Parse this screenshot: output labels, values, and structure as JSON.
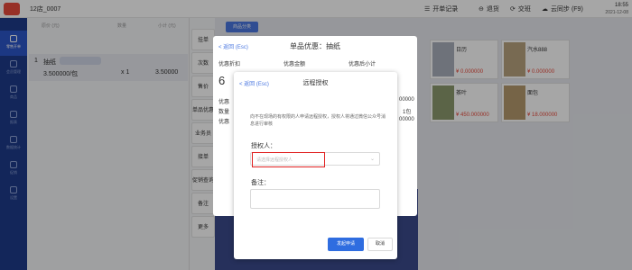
{
  "header": {
    "store": "12店_0007",
    "actions": [
      "开单记录",
      "退货",
      "交班",
      "云同步 (F9)"
    ],
    "time": "18:55",
    "date": "2021-12-08"
  },
  "sidebar": {
    "items": [
      {
        "label": "零售开单",
        "icon": "cart-icon"
      },
      {
        "label": "会员管理",
        "icon": "member-icon"
      },
      {
        "label": "商品",
        "icon": "goods-icon"
      },
      {
        "label": "报表",
        "icon": "report-icon"
      },
      {
        "label": "数据统计",
        "icon": "chart-icon"
      },
      {
        "label": "促销",
        "icon": "promo-icon"
      },
      {
        "label": "设置",
        "icon": "settings-icon"
      }
    ]
  },
  "cart": {
    "headers": {
      "price": "原价 (元)",
      "qty": "数量",
      "subtotal": "小计 (元)"
    },
    "row": {
      "index": "1",
      "name": "抽纸",
      "price": "3.500000/包",
      "qty": "x 1",
      "subtotal": "3.50000"
    }
  },
  "action_buttons": [
    "挂单",
    "次数",
    "售价",
    "单品优惠",
    "业务员",
    "接单",
    "促销查询",
    "备注",
    "更多"
  ],
  "products": {
    "tab": "商品分类",
    "tiles": [
      {
        "name": "日历",
        "price": "¥ 0.000000"
      },
      {
        "name": "汽水888",
        "price": "¥ 0.000000"
      },
      {
        "name": "茶叶",
        "price": "¥ 450.000000"
      },
      {
        "name": "面包",
        "price": "¥ 18.000000"
      }
    ]
  },
  "discount_dialog": {
    "back": "< 返回 (Esc)",
    "title": "单品优惠：抽纸",
    "labels": [
      "优惠折扣",
      "优惠金额",
      "优惠后小计"
    ],
    "discount_value": "6",
    "right_vals": [
      "00000",
      "1包",
      "00000"
    ],
    "left_labels": [
      "优惠",
      "数量",
      "优惠"
    ]
  },
  "auth_dialog": {
    "back": "< 返回 (Esc)",
    "title": "远程授权",
    "description": "向不在现场的有权限的人申请远程授权，授权人将通过微信公众号消息进行审核",
    "authorizer_label": "授权人：",
    "authorizer_placeholder": "请选择远程授权人",
    "remark_label": "备注：",
    "submit": "发起申请",
    "cancel": "取消"
  },
  "colors": {
    "brand": "#1e3b8a",
    "primary": "#2f6de0",
    "highlight": "#e02020"
  }
}
